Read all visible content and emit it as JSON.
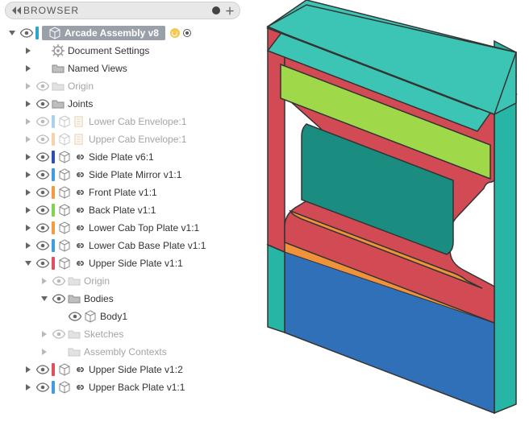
{
  "header": {
    "title": "BROWSER"
  },
  "root": {
    "label": "Arcade Assembly v8",
    "color": "#2aa7c9"
  },
  "items": [
    {
      "indent": 1,
      "arrow": "right",
      "icon": "gear",
      "label": "Document Settings"
    },
    {
      "indent": 1,
      "arrow": "right",
      "icon": "folder",
      "label": "Named Views"
    },
    {
      "indent": 1,
      "arrow": "right",
      "eye": true,
      "dim": true,
      "icon": "folder",
      "label": "Origin"
    },
    {
      "indent": 1,
      "arrow": "right",
      "eye": true,
      "icon": "folder",
      "label": "Joints"
    },
    {
      "indent": 1,
      "arrow": "right",
      "eye": true,
      "dim": true,
      "color": "#3f9de0",
      "icon": "box",
      "sub": "sheet",
      "label": "Lower Cab Envelope:1"
    },
    {
      "indent": 1,
      "arrow": "right",
      "eye": true,
      "dim": true,
      "color": "#f29b3f",
      "icon": "box",
      "sub": "sheet",
      "label": "Upper Cab Envelope:1"
    },
    {
      "indent": 1,
      "arrow": "right",
      "eye": true,
      "color": "#2d4fb3",
      "icon": "box",
      "sub": "link",
      "label": "Side Plate v6:1"
    },
    {
      "indent": 1,
      "arrow": "right",
      "eye": true,
      "color": "#3f9de0",
      "icon": "box",
      "sub": "link",
      "label": "Side Plate Mirror v1:1"
    },
    {
      "indent": 1,
      "arrow": "right",
      "eye": true,
      "color": "#f29b3f",
      "icon": "box",
      "sub": "link",
      "label": "Front Plate v1:1"
    },
    {
      "indent": 1,
      "arrow": "right",
      "eye": true,
      "color": "#7fd34f",
      "icon": "box",
      "sub": "link",
      "label": "Back Plate v1:1"
    },
    {
      "indent": 1,
      "arrow": "right",
      "eye": true,
      "color": "#f29b3f",
      "icon": "box",
      "sub": "link",
      "label": "Lower Cab Top Plate v1:1"
    },
    {
      "indent": 1,
      "arrow": "right",
      "eye": true,
      "color": "#3f9de0",
      "icon": "box",
      "sub": "link",
      "label": "Lower Cab Base Plate v1:1"
    },
    {
      "indent": 1,
      "arrow": "down",
      "eye": true,
      "color": "#e04f5f",
      "icon": "box",
      "sub": "link",
      "label": "Upper Side Plate v1:1"
    },
    {
      "indent": 2,
      "arrow": "right",
      "eye": true,
      "dim": true,
      "icon": "folder",
      "label": "Origin"
    },
    {
      "indent": 2,
      "arrow": "down",
      "eye": true,
      "icon": "folder",
      "label": "Bodies"
    },
    {
      "indent": 3,
      "arrow": "none",
      "eye": true,
      "icon": "body",
      "label": "Body1"
    },
    {
      "indent": 2,
      "arrow": "right",
      "eye": true,
      "dim": true,
      "icon": "folder",
      "label": "Sketches"
    },
    {
      "indent": 2,
      "arrow": "right",
      "dim": true,
      "icon": "folder",
      "label": "Assembly Contexts"
    },
    {
      "indent": 1,
      "arrow": "right",
      "eye": true,
      "color": "#e04f5f",
      "icon": "box",
      "sub": "link",
      "label": "Upper Side Plate v1:2"
    },
    {
      "indent": 1,
      "arrow": "right",
      "eye": true,
      "color": "#3f9de0",
      "icon": "box",
      "sub": "link",
      "label": "Upper Back Plate v1:1"
    }
  ]
}
